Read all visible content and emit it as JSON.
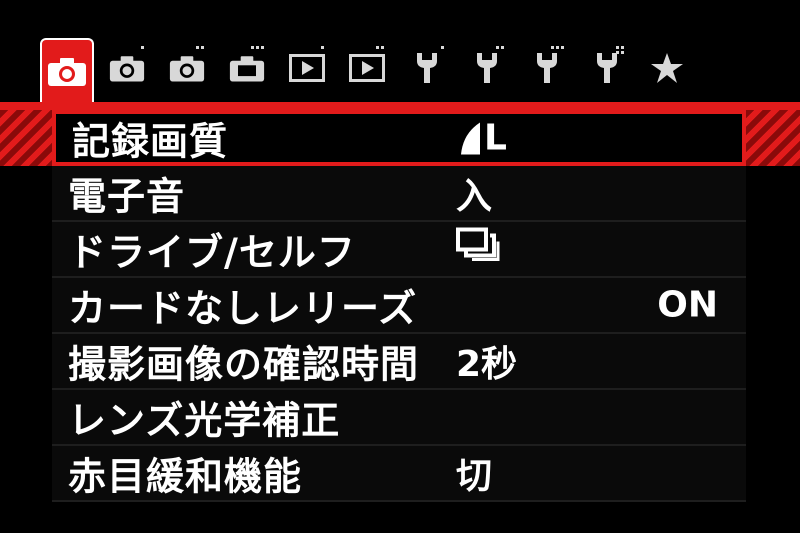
{
  "tabs": [
    {
      "name": "tab-shooting-1",
      "icon": "camera-icon",
      "dots": 0,
      "active": true
    },
    {
      "name": "tab-shooting-2",
      "icon": "camera-icon",
      "dots": 1,
      "active": false
    },
    {
      "name": "tab-shooting-3",
      "icon": "camera-icon",
      "dots": 2,
      "active": false
    },
    {
      "name": "tab-shooting-4",
      "icon": "camera-icon",
      "dots": 3,
      "active": false
    },
    {
      "name": "tab-playback-1",
      "icon": "playback-icon",
      "dots": 1,
      "active": false
    },
    {
      "name": "tab-playback-2",
      "icon": "playback-icon",
      "dots": 2,
      "active": false
    },
    {
      "name": "tab-setup-1",
      "icon": "wrench-icon",
      "dots": 1,
      "active": false
    },
    {
      "name": "tab-setup-2",
      "icon": "wrench-icon",
      "dots": 2,
      "active": false
    },
    {
      "name": "tab-setup-3",
      "icon": "wrench-icon",
      "dots": 3,
      "active": false
    },
    {
      "name": "tab-setup-4",
      "icon": "wrench-icon",
      "dots": 4,
      "active": false
    },
    {
      "name": "tab-my-menu",
      "icon": "star-icon",
      "dots": 0,
      "active": false
    }
  ],
  "menu": {
    "items": [
      {
        "label": "記録画質",
        "value": "L",
        "value_icon": "image-quality-large-fine-icon",
        "selected": true
      },
      {
        "label": "電子音",
        "value": "入",
        "selected": false
      },
      {
        "label": "ドライブ/セルフ",
        "value": "",
        "value_icon": "continuous-drive-icon",
        "selected": false
      },
      {
        "label": "カードなしレリーズ",
        "value": "ON",
        "selected": false
      },
      {
        "label": "撮影画像の確認時間",
        "value": "2秒",
        "selected": false
      },
      {
        "label": "レンズ光学補正",
        "value": "",
        "selected": false
      },
      {
        "label": "赤目緩和機能",
        "value": "切",
        "selected": false
      }
    ]
  },
  "colors": {
    "accent": "#e21b1b",
    "background": "#000000",
    "text": "#ffffff",
    "icon_inactive": "#d8d8d8"
  }
}
